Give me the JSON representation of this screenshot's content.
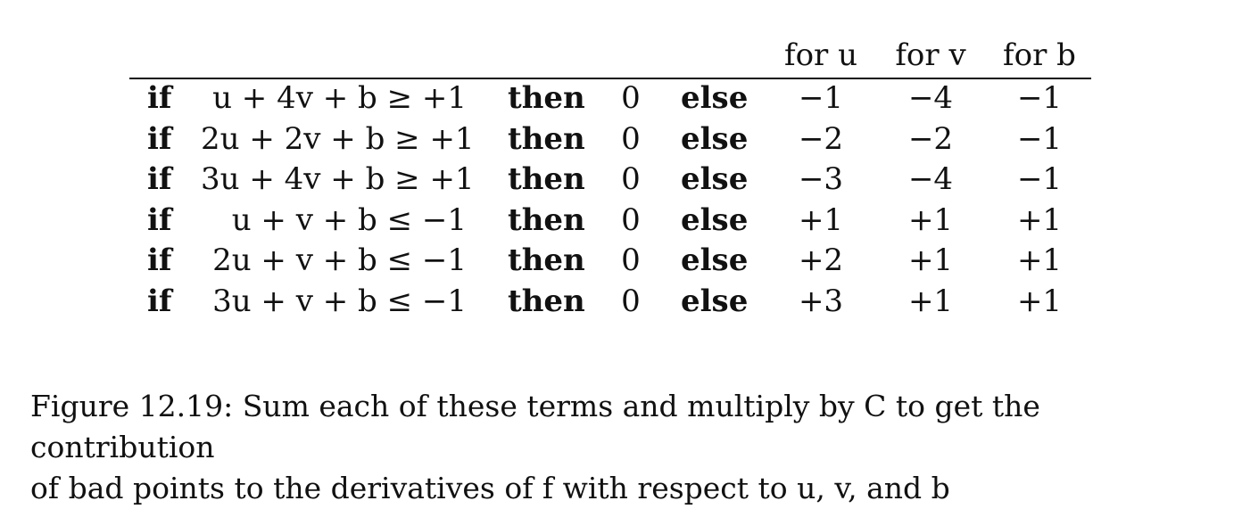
{
  "table": {
    "headers": {
      "for_u": "for u",
      "for_v": "for v",
      "for_b": "for b"
    },
    "rows": [
      {
        "if": "if",
        "condition": "u + 4v + b ≥ +1",
        "then": "then",
        "zero": "0",
        "else": "else",
        "u": "−1",
        "v": "−4",
        "b": "−1"
      },
      {
        "if": "if",
        "condition": "2u + 2v + b ≥ +1",
        "then": "then",
        "zero": "0",
        "else": "else",
        "u": "−2",
        "v": "−2",
        "b": "−1"
      },
      {
        "if": "if",
        "condition": "3u + 4v + b ≥ +1",
        "then": "then",
        "zero": "0",
        "else": "else",
        "u": "−3",
        "v": "−4",
        "b": "−1"
      },
      {
        "if": "if",
        "condition": "u + v + b ≤ −1",
        "then": "then",
        "zero": "0",
        "else": "else",
        "u": "+1",
        "v": "+1",
        "b": "+1"
      },
      {
        "if": "if",
        "condition": "2u + v + b ≤ −1",
        "then": "then",
        "zero": "0",
        "else": "else",
        "u": "+2",
        "v": "+1",
        "b": "+1"
      },
      {
        "if": "if",
        "condition": "3u + v + b ≤ −1",
        "then": "then",
        "zero": "0",
        "else": "else",
        "u": "+3",
        "v": "+1",
        "b": "+1"
      }
    ]
  },
  "caption": {
    "line1": "Figure 12.19: Sum each of these terms and multiply by C to get the contribution",
    "line2": "of bad points to the derivatives of f with respect to u, v, and b"
  }
}
